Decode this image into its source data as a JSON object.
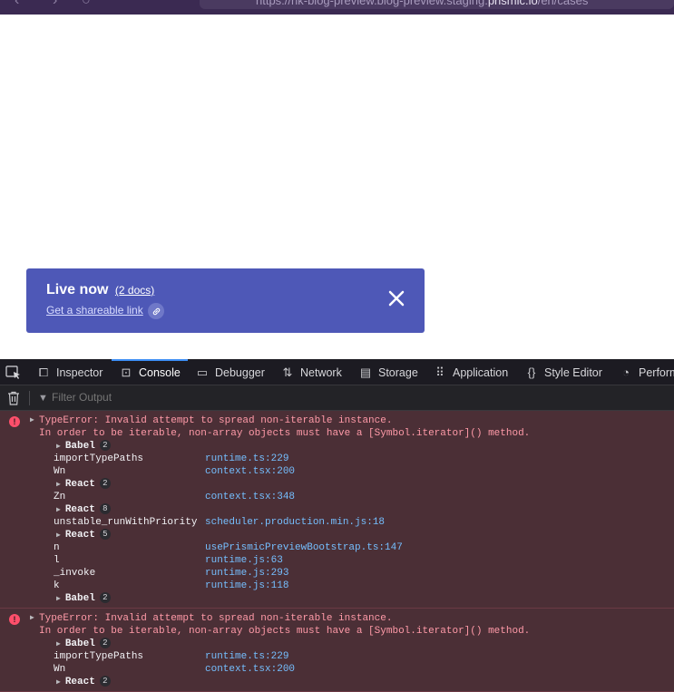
{
  "browser": {
    "url_prefix": "https://nk-blog-preview.blog-preview.staging.",
    "url_domain": "prismic.io",
    "url_suffix": "/en/cases"
  },
  "toolbar": {
    "title": "Live now",
    "docs": "(2 docs)",
    "share_link": "Get a shareable link"
  },
  "devtools": {
    "tabs": [
      {
        "label": "Inspector",
        "icon": "inspector-icon"
      },
      {
        "label": "Console",
        "icon": "console-icon"
      },
      {
        "label": "Debugger",
        "icon": "debugger-icon"
      },
      {
        "label": "Network",
        "icon": "network-icon"
      },
      {
        "label": "Storage",
        "icon": "storage-icon"
      },
      {
        "label": "Application",
        "icon": "application-icon"
      },
      {
        "label": "Style Editor",
        "icon": "style-editor-icon"
      },
      {
        "label": "Perform",
        "icon": "performance-icon"
      }
    ],
    "active_tab": "Console",
    "filter_placeholder": "Filter Output"
  },
  "console": {
    "messages": [
      {
        "error": "TypeError: Invalid attempt to spread non-iterable instance.",
        "detail": "In order to be iterable, non-array objects must have a [Symbol.iterator]() method.",
        "stack": [
          {
            "group": "Babel",
            "count": "2"
          },
          {
            "fn": "importTypePaths",
            "loc": "runtime.ts:229"
          },
          {
            "fn": "Wn",
            "loc": "context.tsx:200"
          },
          {
            "group": "React",
            "count": "2"
          },
          {
            "fn": "Zn",
            "loc": "context.tsx:348"
          },
          {
            "group": "React",
            "count": "8"
          },
          {
            "fn": "unstable_runWithPriority",
            "loc": "scheduler.production.min.js:18"
          },
          {
            "group": "React",
            "count": "5"
          },
          {
            "fn": "n",
            "loc": "usePrismicPreviewBootstrap.ts:147"
          },
          {
            "fn": "l",
            "loc": "runtime.js:63"
          },
          {
            "fn": "_invoke",
            "loc": "runtime.js:293"
          },
          {
            "fn": "k",
            "loc": "runtime.js:118"
          },
          {
            "group": "Babel",
            "count": "2"
          }
        ]
      },
      {
        "error": "TypeError: Invalid attempt to spread non-iterable instance.",
        "detail": "In order to be iterable, non-array objects must have a [Symbol.iterator]() method.",
        "stack": [
          {
            "group": "Babel",
            "count": "2"
          },
          {
            "fn": "importTypePaths",
            "loc": "runtime.ts:229"
          },
          {
            "fn": "Wn",
            "loc": "context.tsx:200"
          },
          {
            "group": "React",
            "count": "2"
          }
        ]
      }
    ]
  },
  "colors": {
    "toolbar_bg": "#4e58b7",
    "devtools_bg": "#232327",
    "error_row_bg": "#4b2f36",
    "error_text": "#ff9aa8",
    "link_blue": "#75bfff",
    "active_tab_underline": "#3d8ef4"
  }
}
